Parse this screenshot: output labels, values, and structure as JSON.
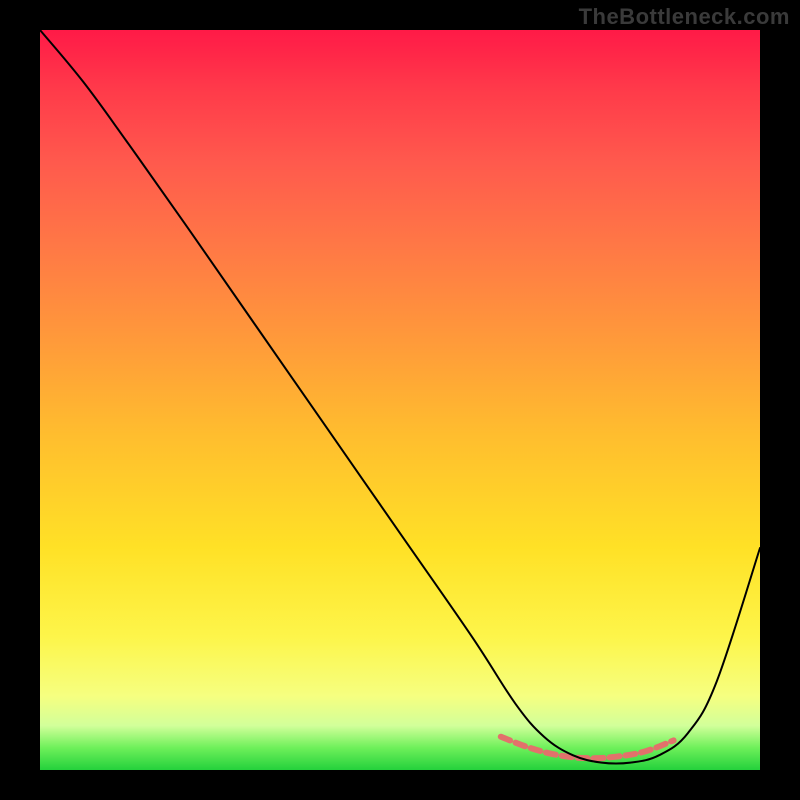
{
  "watermark": "TheBottleneck.com",
  "chart_data": {
    "type": "line",
    "title": "",
    "xlabel": "",
    "ylabel": "",
    "xlim": [
      0,
      100
    ],
    "ylim": [
      0,
      100
    ],
    "gradient_stops": [
      {
        "offset": 0,
        "color": "#ff1a47"
      },
      {
        "offset": 8,
        "color": "#ff3a4a"
      },
      {
        "offset": 18,
        "color": "#ff5a4d"
      },
      {
        "offset": 30,
        "color": "#ff7a45"
      },
      {
        "offset": 42,
        "color": "#ff9a3a"
      },
      {
        "offset": 55,
        "color": "#ffbe2e"
      },
      {
        "offset": 70,
        "color": "#ffe126"
      },
      {
        "offset": 82,
        "color": "#fdf54a"
      },
      {
        "offset": 90,
        "color": "#f6ff80"
      },
      {
        "offset": 94,
        "color": "#d2ff9a"
      },
      {
        "offset": 97,
        "color": "#6ef05a"
      },
      {
        "offset": 100,
        "color": "#24d13c"
      }
    ],
    "series": [
      {
        "name": "bottleneck-curve",
        "color": "#000000",
        "stroke_width": 2,
        "x": [
          0,
          6,
          12,
          20,
          30,
          40,
          50,
          60,
          66,
          70,
          74,
          78,
          82,
          86,
          90,
          94,
          100
        ],
        "values": [
          100,
          93,
          85,
          74,
          60,
          46,
          32,
          18,
          9,
          4.5,
          2,
          1,
          1,
          2,
          5,
          12,
          30
        ]
      },
      {
        "name": "optimal-band",
        "color": "#e2726b",
        "stroke_width": 6,
        "stroke_dasharray": "10,6",
        "x": [
          64,
          68,
          72,
          76,
          80,
          84,
          88
        ],
        "values": [
          4.5,
          3.0,
          2.0,
          1.6,
          1.8,
          2.5,
          4.0
        ]
      }
    ]
  }
}
